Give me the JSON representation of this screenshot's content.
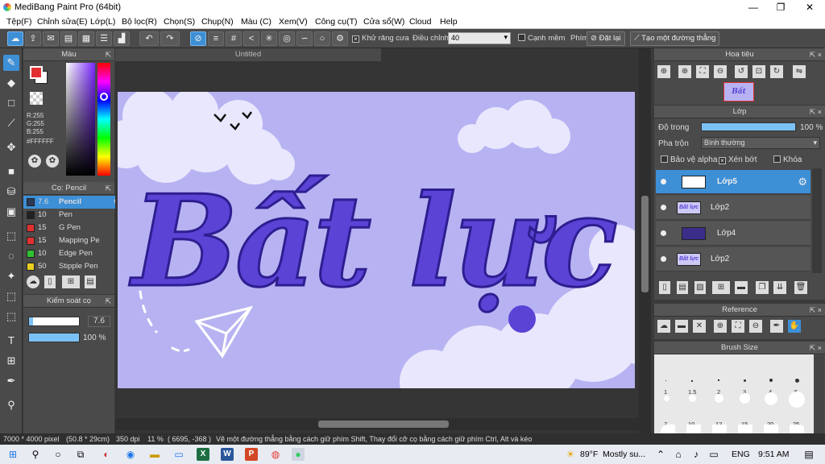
{
  "window": {
    "title": "MediBang Paint Pro (64bit)",
    "min": "—",
    "max": "❐",
    "close": "✕"
  },
  "menu": [
    "Tệp(F)",
    "Chỉnh sửa(E)",
    "Lớp(L)",
    "Bộ lọc(R)",
    "Chọn(S)",
    "Chụp(N)",
    "Màu (C)",
    "Xem(V)",
    "Công cụ(T)",
    "Cửa sổ(W)",
    "Cloud",
    "Help"
  ],
  "toolbar": {
    "antialias_label": "Khử răng cưa",
    "correction_label": "Điều chỉnh",
    "correction_value": "40",
    "soft_edge_label": "Cạnh mềm",
    "key_label": "Phím",
    "reset_label": "Đặt lại",
    "line_label": "Tạo một đường thẳng"
  },
  "color_panel": {
    "title": "Màu",
    "r": "R:255",
    "g": "G:255",
    "b": "B:255",
    "hex": "#FFFFFF"
  },
  "brush_panel": {
    "title": "Cọ: Pencil",
    "items": [
      {
        "size": "7.6",
        "name": "Pencil",
        "color": "#2b3a55",
        "selected": true
      },
      {
        "size": "10",
        "name": "Pen",
        "color": "#222222",
        "selected": false
      },
      {
        "size": "15",
        "name": "G Pen",
        "color": "#e03030",
        "selected": false
      },
      {
        "size": "15",
        "name": "Mapping Pe",
        "color": "#e03030",
        "selected": false
      },
      {
        "size": "10",
        "name": "Edge Pen",
        "color": "#30c030",
        "selected": false
      },
      {
        "size": "50",
        "name": "Stipple Pen",
        "color": "#e8d020",
        "selected": false
      }
    ]
  },
  "brush_control": {
    "title": "Kiểm soát cọ",
    "size": "7.6",
    "opacity": "100 %",
    "size_fraction": 0.08,
    "opacity_fraction": 1.0
  },
  "document": {
    "tab": "Untitled",
    "art_title": "Bất lực"
  },
  "navigator": {
    "title": "Hoa tiêu",
    "thumb_text": "Bất lực"
  },
  "layer_panel": {
    "title": "Lớp",
    "opacity_label": "Độ trong",
    "opacity_value": "100 %",
    "blend_label": "Pha trộn",
    "blend_value": "Bình thường",
    "protect_alpha": "Bảo vệ alpha",
    "clipping": "Xén bớt",
    "lock": "Khóa",
    "layers": [
      {
        "name": "Lớp5",
        "selected": true,
        "thumb": "",
        "indent": true
      },
      {
        "name": "Lớp2",
        "selected": false,
        "thumb": "Bất lực",
        "indent": false
      },
      {
        "name": "Lớp4",
        "selected": false,
        "thumb": "",
        "indent": true
      },
      {
        "name": "Lớp2",
        "selected": false,
        "thumb": "Bất lực",
        "indent": false
      }
    ]
  },
  "reference_panel": {
    "title": "Reference"
  },
  "brush_size_panel": {
    "title": "Brush Size",
    "row1": [
      "1",
      "1.5",
      "2",
      "3",
      "4",
      "5"
    ],
    "row2": [
      "7",
      "10",
      "12",
      "15",
      "20",
      "25"
    ]
  },
  "status": {
    "pixels": "7000 * 4000 pixel",
    "cm": "(50.8 * 29cm)",
    "dpi": "350 dpi",
    "zoom": "11 %",
    "coords": "( 6695, -368 )",
    "hint": "Vẽ một đường thẳng bằng cách giữ phím Shift, Thay đổi cỡ cọ bằng cách giữ phím Ctrl, Alt và kéo"
  },
  "taskbar": {
    "weather_temp": "89°F",
    "weather_text": "Mostly su...",
    "lang": "ENG",
    "time": "9:51 AM"
  },
  "colors": {
    "accent": "#3d8fd6",
    "panel": "#4a4a4a",
    "canvas_bg": "#b7b3f2",
    "lettering": "#5b43d6"
  }
}
